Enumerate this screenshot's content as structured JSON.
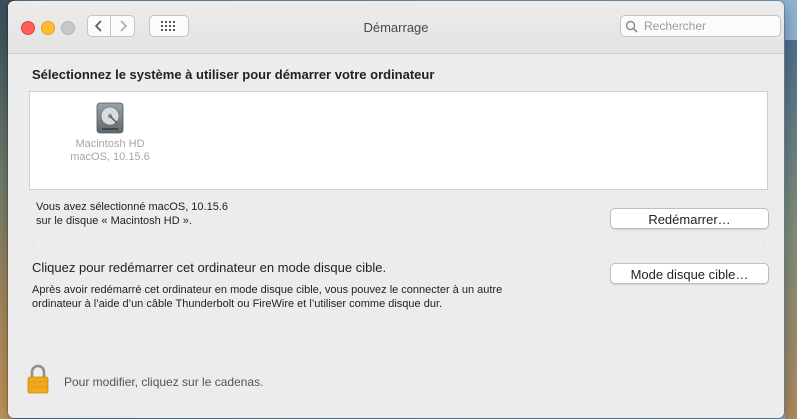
{
  "window": {
    "title": "Démarrage",
    "search": {
      "placeholder": "Rechercher",
      "value": ""
    }
  },
  "main": {
    "heading": "Sélectionnez le système à utiliser pour démarrer votre ordinateur",
    "disks": [
      {
        "name": "Macintosh HD",
        "os": "macOS, 10.15.6",
        "icon": "hard-disk-icon"
      }
    ],
    "selection": {
      "line1": "Vous avez sélectionné macOS, 10.15.6",
      "line2": "sur le disque « Macintosh HD »."
    },
    "restart_button": "Redémarrer…",
    "dots": ".",
    "target_disk": {
      "title": "Cliquez pour redémarrer cet ordinateur en mode disque cible.",
      "description_line1": "Après avoir redémarré cet ordinateur en mode disque cible, vous pouvez le connecter à un autre",
      "description_line2": "ordinateur à l’aide d’un câble Thunderbolt ou FireWire et l’utiliser comme disque dur.",
      "button": "Mode disque cible…"
    }
  },
  "footer": {
    "lock_text": "Pour modifier, cliquez sur le cadenas.",
    "lock_icon": "padlock-icon"
  },
  "colors": {
    "close": "#fe5f57",
    "minimize": "#febc2e",
    "window_bg": "#ececec",
    "lock": "#f0a81c"
  }
}
